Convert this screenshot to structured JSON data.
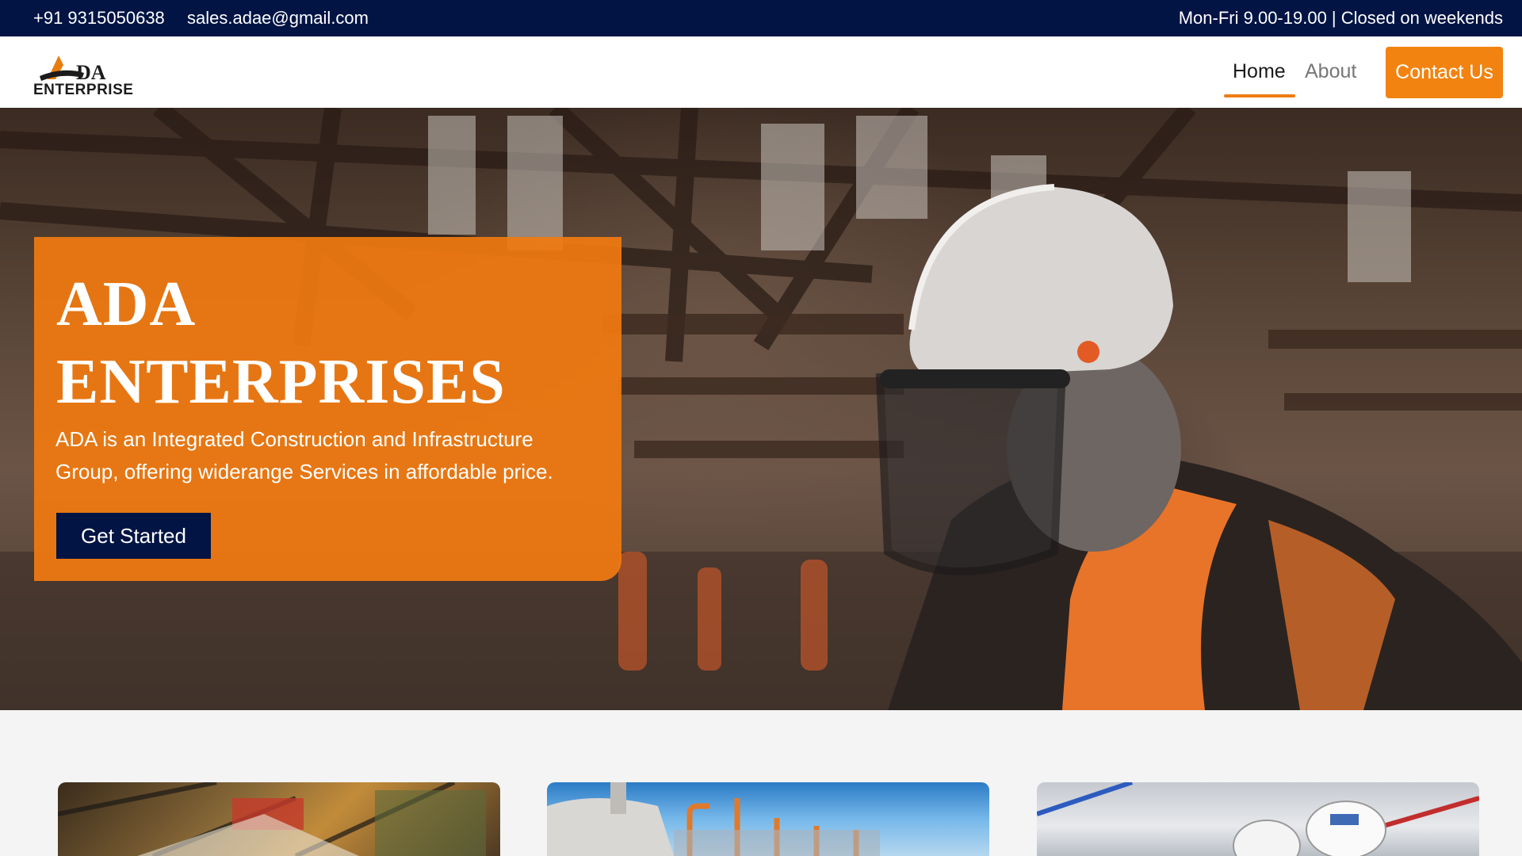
{
  "topbar": {
    "phone": "+91 9315050638",
    "email": "sales.adae@gmail.com",
    "hours": "Mon-Fri 9.00-19.00 | Closed on weekends"
  },
  "header": {
    "logo_text_top": "DA",
    "logo_text_bottom": "ENTERPRISE",
    "nav": {
      "home": "Home",
      "about": "About"
    },
    "contact_label": "Contact Us"
  },
  "hero": {
    "title_line1": "ADA",
    "title_line2": "ENTERPRISES",
    "description": "ADA is an Integrated Construction and Infrastructure Group, offering widerange Services in affordable price.",
    "cta_label": "Get Started"
  },
  "colors": {
    "navy": "#021444",
    "orange": "#f28310",
    "hero_overlay": "#f07a10"
  },
  "icons": {
    "logo": "ada-enterprise-logo"
  }
}
